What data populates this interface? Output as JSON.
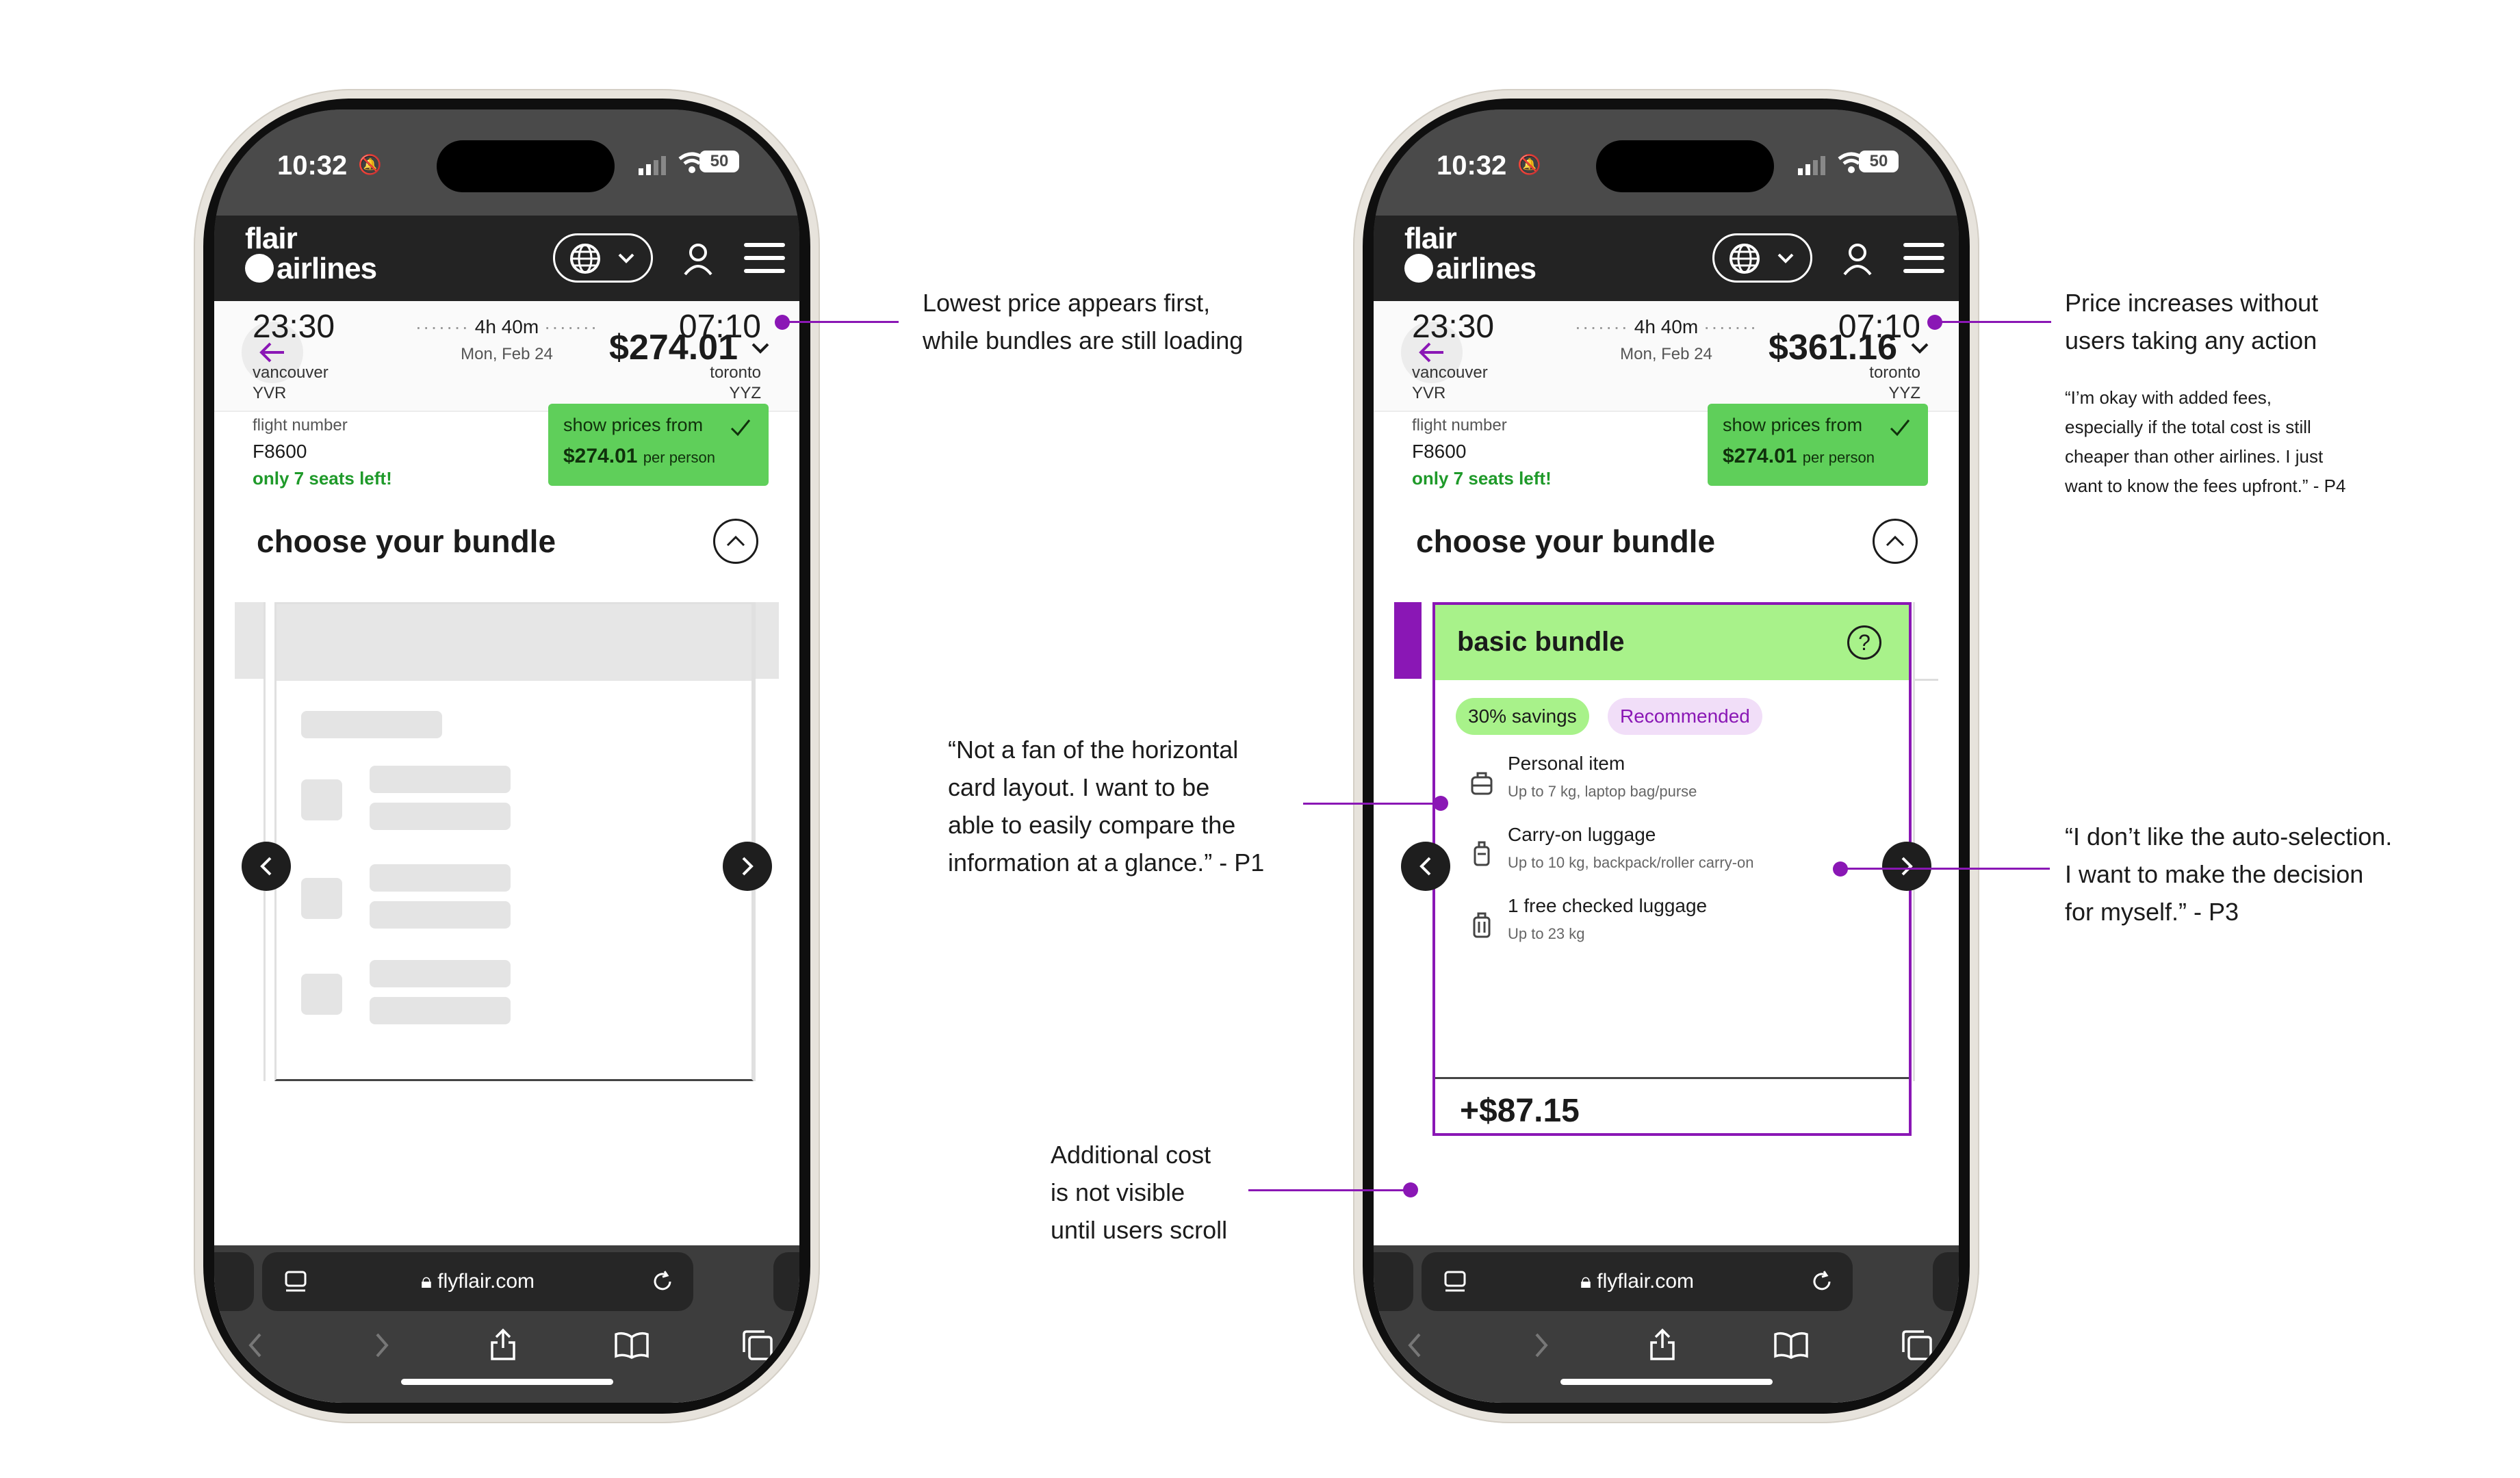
{
  "status_bar": {
    "time": "10:32",
    "battery": "50"
  },
  "app": {
    "logo_line1": "flair",
    "logo_line2": "airlines"
  },
  "phone_left": {
    "price": "$274.01",
    "url": "flyflair.com"
  },
  "phone_right": {
    "price": "$361.16",
    "url": "flyflair.com",
    "bundle": {
      "title": "basic bundle",
      "savings": "30% savings",
      "recommended": "Recommended",
      "items": [
        {
          "title": "Personal item",
          "sub": "Up to 7 kg, laptop bag/purse",
          "icon": "backpack-icon"
        },
        {
          "title": "Carry-on luggage",
          "sub": "Up to 10 kg, backpack/roller carry-on",
          "icon": "carry-on-icon"
        },
        {
          "title": "1 free checked luggage",
          "sub": "Up to 23 kg",
          "icon": "suitcase-icon"
        }
      ],
      "cost_partial": "+$87.15"
    }
  },
  "flight": {
    "depart_time": "23:30",
    "arrive_time": "07:10",
    "duration": "4h 40m",
    "date": "Mon, Feb 24",
    "origin_city": "vancouver",
    "origin_code": "YVR",
    "dest_city": "toronto",
    "dest_code": "YYZ",
    "flight_number_label": "flight number",
    "flight_number": "F8600",
    "seats_left": "only 7 seats left!",
    "show_prices_label": "show prices from",
    "show_prices_value": "$274.01",
    "per_person": "per person"
  },
  "choose_bundle": "choose your bundle",
  "annotations": {
    "a1": [
      "Lowest price appears first,",
      "while bundles are still loading"
    ],
    "a2": [
      "“Not a fan of the horizontal",
      "card layout. I want to be",
      "able to easily compare the",
      "information at a glance.” - P1"
    ],
    "a3": [
      "Additional cost",
      "is not visible",
      "until users scroll"
    ],
    "a4": [
      "Price increases without",
      "users taking any action"
    ],
    "a4_quote": [
      "“I’m okay with added fees,",
      "especially if the total cost is still",
      "cheaper than other airlines. I just",
      "want to know the fees upfront.” - P4"
    ],
    "a5": [
      "“I don’t like the auto-selection.",
      "I want to make the decision",
      "for myself.” - P3"
    ]
  },
  "colors": {
    "accent": "#8a17b5",
    "green": "#5fcf5a",
    "bundle_header": "#a8f28a",
    "dark": "#232323"
  }
}
